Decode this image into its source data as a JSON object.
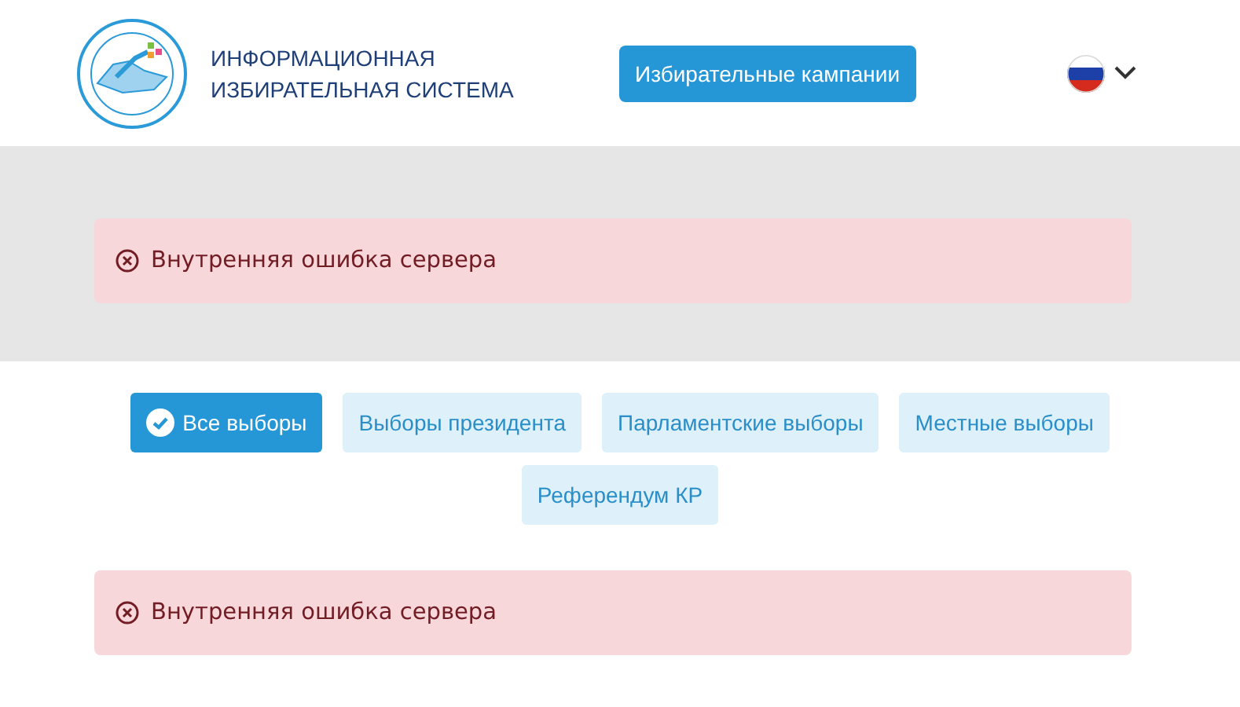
{
  "header": {
    "title_lines": [
      "ИНФОРМАЦИОННАЯ",
      "ИЗБИРАТЕЛЬНАЯ СИСТЕМА"
    ],
    "campaigns_button": "Избирательные кампании",
    "language": {
      "expanded": false
    }
  },
  "top_alert": {
    "message": "Внутренняя ошибка сервера"
  },
  "filters": [
    {
      "label": "Все выборы",
      "selected": true
    },
    {
      "label": "Выборы президента",
      "selected": false
    },
    {
      "label": "Парламентские выборы",
      "selected": false
    },
    {
      "label": "Местные выборы",
      "selected": false
    },
    {
      "label": "Референдум КР",
      "selected": false
    }
  ],
  "bottom_alert": {
    "message": "Внутренняя ошибка сервера"
  }
}
